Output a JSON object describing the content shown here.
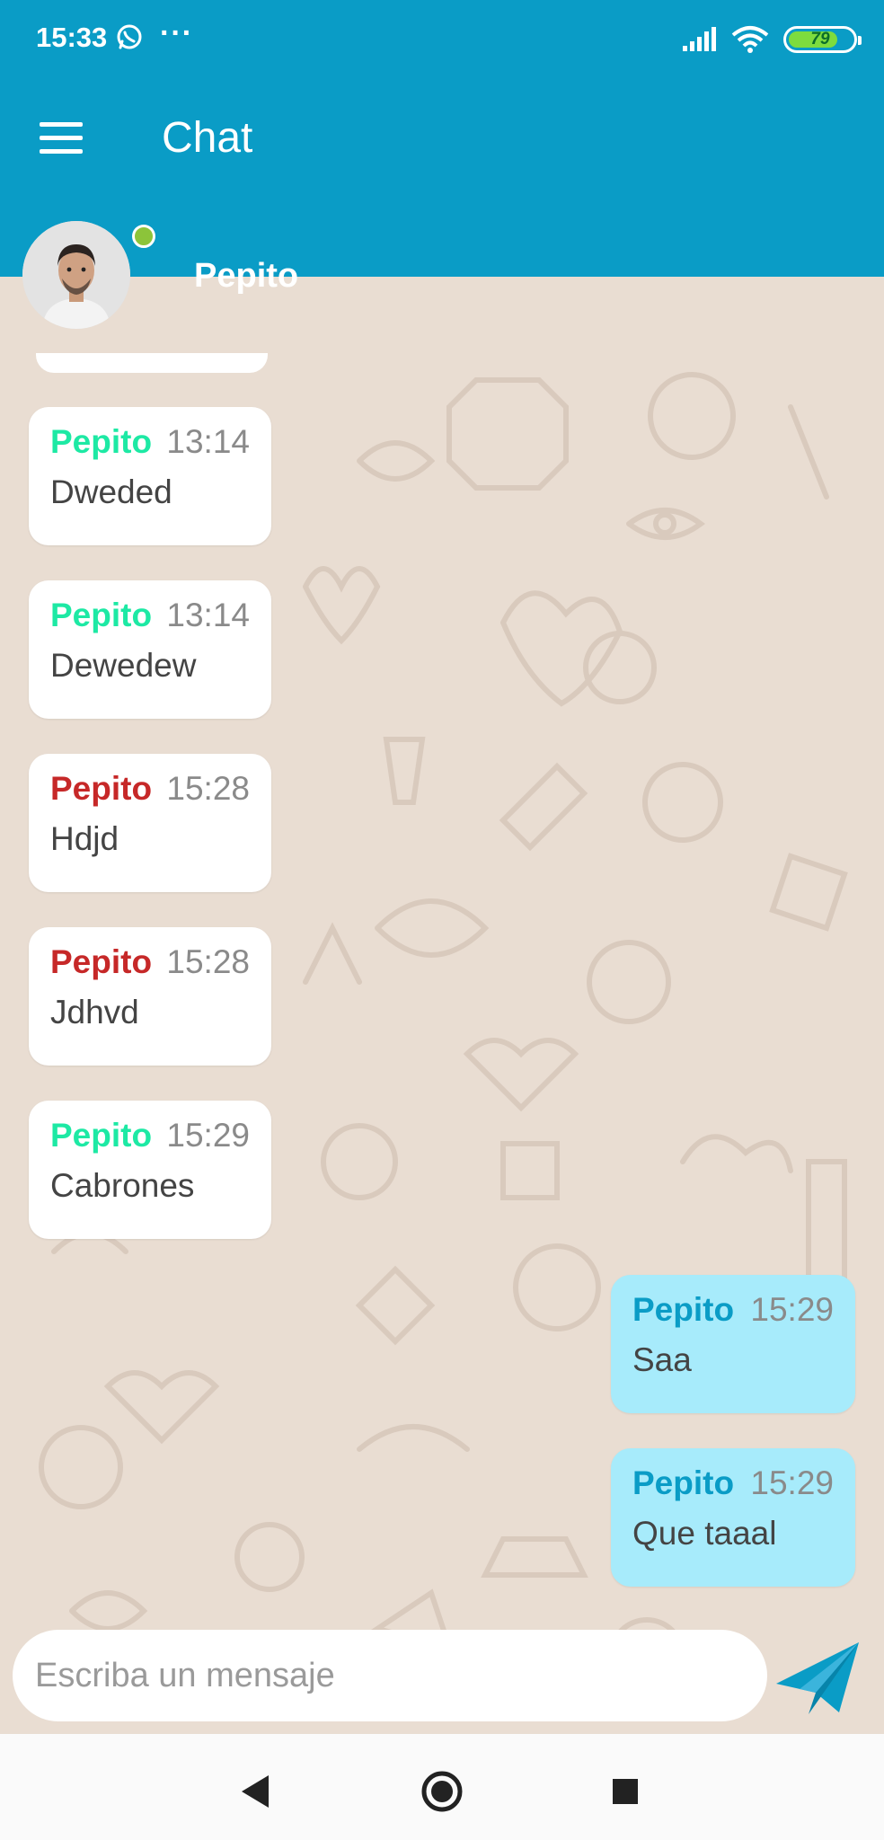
{
  "status_bar": {
    "time": "15:33",
    "battery_level": "79",
    "battery_fraction": 0.79,
    "icons": [
      "whatsapp-icon",
      "more-dots-icon",
      "signal-icon",
      "wifi-icon",
      "battery-icon"
    ]
  },
  "app_bar": {
    "title": "Chat",
    "menu_icon": "menu-icon"
  },
  "contact": {
    "name": "Pepito",
    "online": true
  },
  "messages": [
    {
      "direction": "in",
      "sender": "Pepito",
      "time": "13:14",
      "text": "Dweded",
      "sender_color": "#1de9a4"
    },
    {
      "direction": "in",
      "sender": "Pepito",
      "time": "13:14",
      "text": "Dewedew",
      "sender_color": "#1de9a4"
    },
    {
      "direction": "in",
      "sender": "Pepito",
      "time": "15:28",
      "text": "Hdjd",
      "sender_color": "#c62828"
    },
    {
      "direction": "in",
      "sender": "Pepito",
      "time": "15:28",
      "text": "Jdhvd",
      "sender_color": "#c62828"
    },
    {
      "direction": "in",
      "sender": "Pepito",
      "time": "15:29",
      "text": "Cabrones",
      "sender_color": "#1de9a4"
    },
    {
      "direction": "out",
      "sender": "Pepito",
      "time": "15:29",
      "text": "Saa",
      "sender_color": "#0a9cc6"
    },
    {
      "direction": "out",
      "sender": "Pepito",
      "time": "15:29",
      "text": "Que taaal",
      "sender_color": "#0a9cc6"
    }
  ],
  "composer": {
    "placeholder": "Escriba un mensaje",
    "value": "",
    "send_icon": "send-icon"
  },
  "colors": {
    "primary": "#0a9cc6",
    "outgoing_bubble": "#a7ebfb",
    "incoming_bubble": "#ffffff",
    "chat_background": "#e9ddd2",
    "online": "#8cc43a"
  },
  "nav_bar": {
    "icons": [
      "back-icon",
      "home-icon",
      "recents-icon"
    ]
  }
}
